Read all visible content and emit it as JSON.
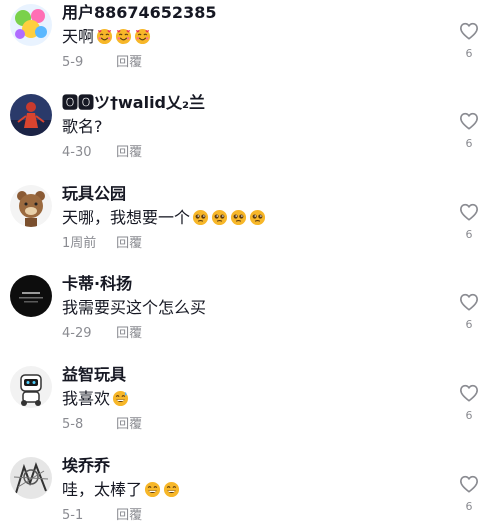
{
  "comments": [
    {
      "username": "用户88674652385",
      "text": "天啊",
      "emoji_icon": "smiling-face-with-hearts-icon",
      "emoji_count": 3,
      "date": "5-9",
      "reply_label": "回覆",
      "likes": "6"
    },
    {
      "username": "🅾🅾ツ†walid乂₂兰",
      "text": "歌名?",
      "emoji_icon": "",
      "emoji_count": 0,
      "date": "4-30",
      "reply_label": "回覆",
      "likes": "6"
    },
    {
      "username": "玩具公园",
      "text": "天哪，我想要一个",
      "emoji_icon": "pleading-face-icon",
      "emoji_count": 4,
      "date": "1周前",
      "reply_label": "回覆",
      "likes": "6"
    },
    {
      "username": "卡蒂·科扬",
      "text": "我需要买这个怎么买",
      "emoji_icon": "",
      "emoji_count": 0,
      "date": "4-29",
      "reply_label": "回覆",
      "likes": "6"
    },
    {
      "username": "益智玩具",
      "text": "我喜欢",
      "emoji_icon": "grinning-sweat-face-icon",
      "emoji_count": 1,
      "date": "5-8",
      "reply_label": "回覆",
      "likes": "6"
    },
    {
      "username": "埃乔乔",
      "text": "哇，太棒了",
      "emoji_icon": "grinning-face-icon",
      "emoji_count": 2,
      "date": "5-1",
      "reply_label": "回覆",
      "likes": "6"
    }
  ],
  "colors": {
    "text": "#161823",
    "muted": "#8a8b91",
    "emoji": "#f7b729"
  }
}
